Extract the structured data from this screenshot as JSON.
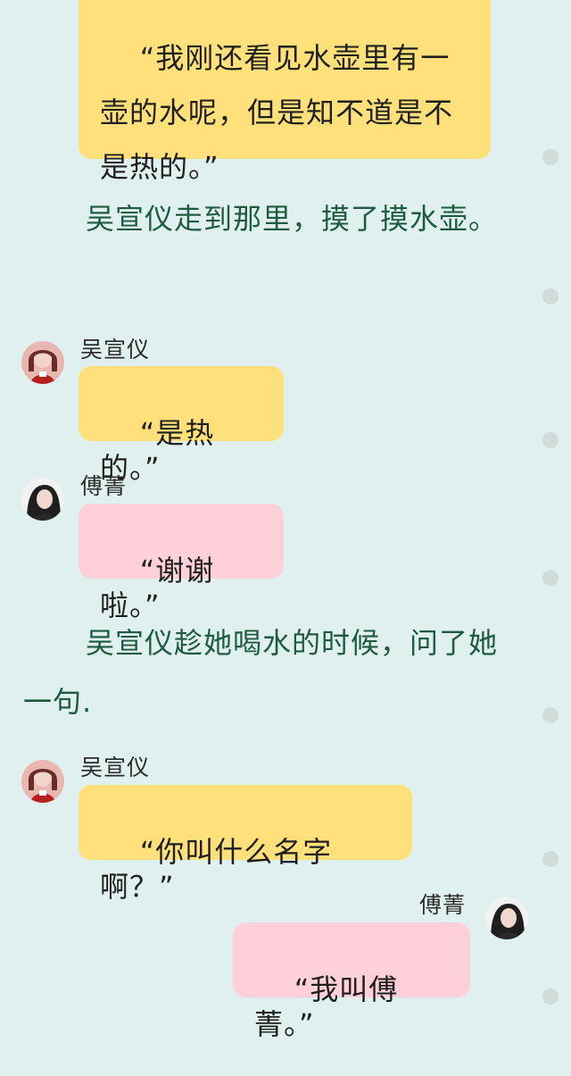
{
  "messages": {
    "m1_text": "“我刚还看见水壶里有一壶的水呢，但是知不道是不是热的。”",
    "m2_name": "吴宣仪",
    "m2_text": "“是热的。”",
    "m3_name": "傅菁",
    "m3_text": "“谢谢啦。”",
    "m4_name": "吴宣仪",
    "m4_text": "“你叫什么名字啊？”",
    "m5_name": "傅菁",
    "m5_text": "“我叫傅菁。”"
  },
  "narration": {
    "n1": "吴宣仪走到那里，摸了摸水壶。",
    "n2": "吴宣仪趁她喝水的时候，问了她一句."
  },
  "colors": {
    "background": "#dff0ee",
    "bubble_yellow": "#ffe07a",
    "bubble_pink": "#ffd0d9",
    "narration_text": "#1e5b40"
  },
  "icons": {
    "avatar_wu": "avatar-wuxuanyi-icon",
    "avatar_fu": "avatar-fujing-icon"
  }
}
